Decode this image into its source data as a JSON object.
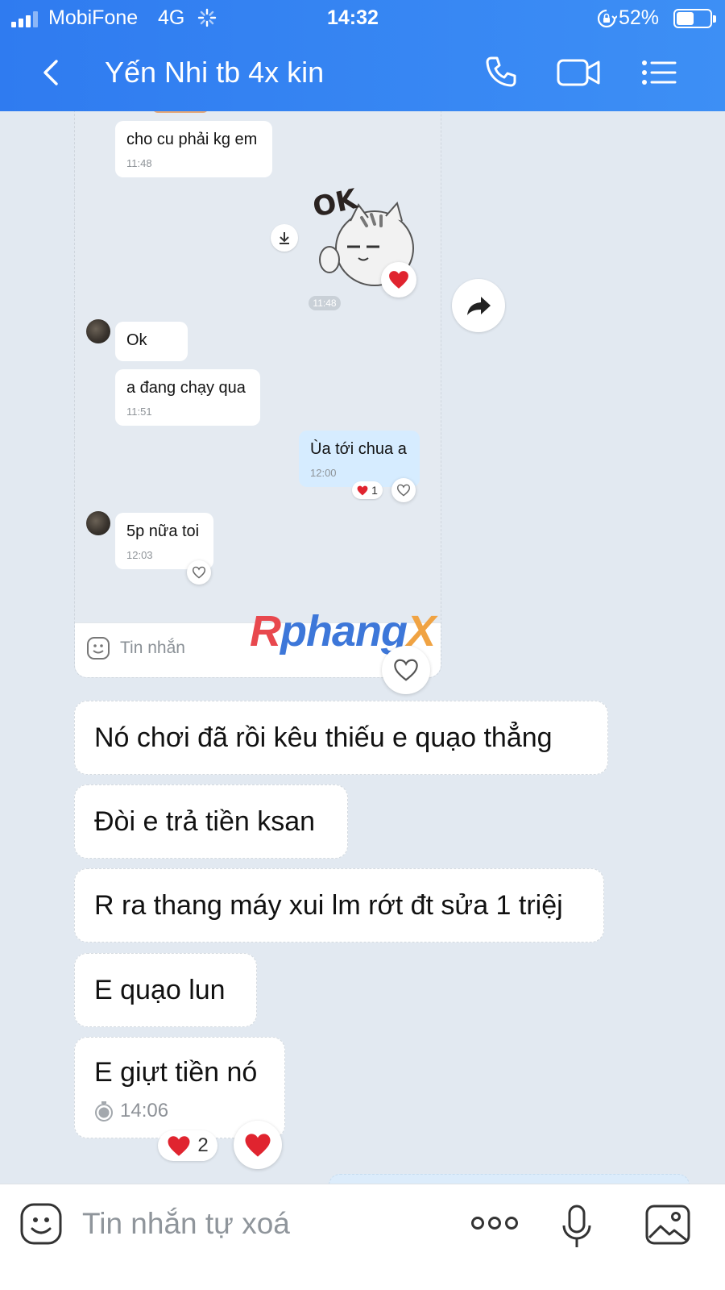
{
  "status_bar": {
    "carrier": "MobiFone",
    "network": "4G",
    "time": "14:32",
    "battery_percent": "52%",
    "battery_level": 0.52
  },
  "header": {
    "title": "Yến Nhi tb 4x kin",
    "icons": [
      "back-icon",
      "phone-icon",
      "video-call-icon",
      "menu-icon"
    ],
    "bg_color": "#3d8ff5"
  },
  "embedded_chat": {
    "messages": [
      {
        "text": "cho cu phải kg em",
        "time": "11:48"
      },
      {
        "sticker_text": "OK",
        "time": "11:48"
      },
      {
        "text": "Ok"
      },
      {
        "text": "a đang chạy qua",
        "time": "11:51"
      },
      {
        "text": "Ùa tới chua a",
        "time": "12:00",
        "reaction_count": "1"
      },
      {
        "text": "5p nữa toi",
        "time": "12:03"
      }
    ],
    "input_placeholder": "Tin nhắn"
  },
  "watermark": {
    "part1": "R",
    "part2": "phang",
    "part3": "X"
  },
  "messages": [
    {
      "text": "Nó chơi đã rồi kêu thiếu e quạo thẳng"
    },
    {
      "text": "Đòi e trả tiền ksan"
    },
    {
      "text": "R ra thang máy xui lm rớt đt sửa 1 triệj"
    },
    {
      "text": "E quạo lun"
    },
    {
      "text": "E giựt tiền nó",
      "time": "14:06",
      "reaction_count": "2"
    }
  ],
  "input": {
    "placeholder": "Tin nhắn tự xoá"
  },
  "colors": {
    "accent": "#3d8ff5",
    "heart": "#e0242f",
    "chat_bg": "#e2e9f1",
    "outgoing_bubble": "#d6ecff"
  }
}
